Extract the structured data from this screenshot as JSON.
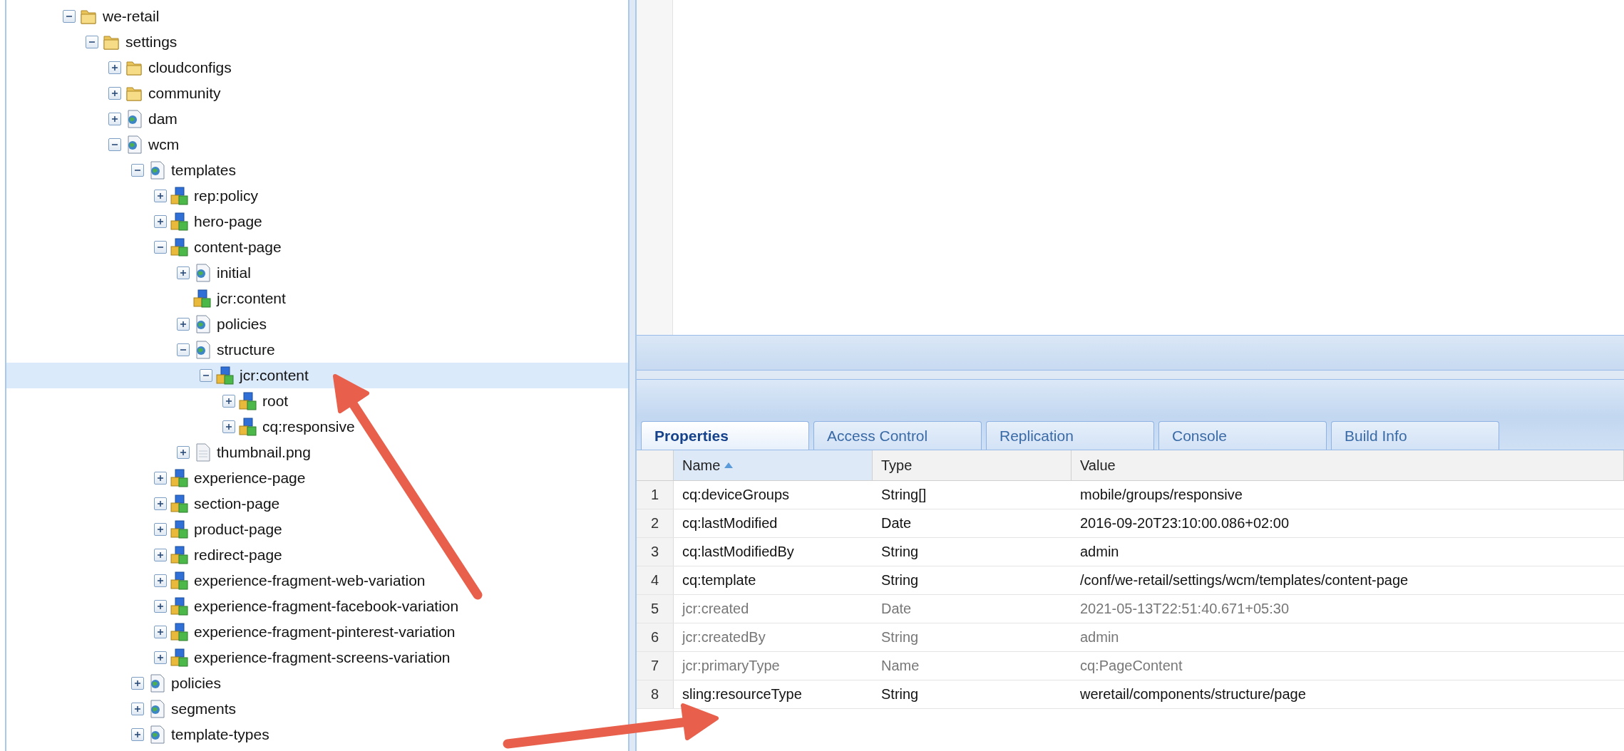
{
  "tree": [
    {
      "label": "we-retail",
      "kind": "folder",
      "leaf": false,
      "expanded": true,
      "selected": false,
      "children": [
        {
          "label": "settings",
          "kind": "folder",
          "leaf": false,
          "expanded": true,
          "selected": false,
          "children": [
            {
              "label": "cloudconfigs",
              "kind": "folder",
              "leaf": false,
              "expanded": false,
              "selected": false
            },
            {
              "label": "community",
              "kind": "folder",
              "leaf": false,
              "expanded": false,
              "selected": false
            },
            {
              "label": "dam",
              "kind": "page",
              "leaf": false,
              "expanded": false,
              "selected": false
            },
            {
              "label": "wcm",
              "kind": "page",
              "leaf": false,
              "expanded": true,
              "selected": false,
              "children": [
                {
                  "label": "templates",
                  "kind": "page",
                  "leaf": false,
                  "expanded": true,
                  "selected": false,
                  "children": [
                    {
                      "label": "rep:policy",
                      "kind": "node",
                      "leaf": false,
                      "expanded": false,
                      "selected": false
                    },
                    {
                      "label": "hero-page",
                      "kind": "node",
                      "leaf": false,
                      "expanded": false,
                      "selected": false
                    },
                    {
                      "label": "content-page",
                      "kind": "node",
                      "leaf": false,
                      "expanded": true,
                      "selected": false,
                      "children": [
                        {
                          "label": "initial",
                          "kind": "page",
                          "leaf": false,
                          "expanded": false,
                          "selected": false
                        },
                        {
                          "label": "jcr:content",
                          "kind": "node",
                          "leaf": true,
                          "selected": false
                        },
                        {
                          "label": "policies",
                          "kind": "page",
                          "leaf": false,
                          "expanded": false,
                          "selected": false
                        },
                        {
                          "label": "structure",
                          "kind": "page",
                          "leaf": false,
                          "expanded": true,
                          "selected": false,
                          "children": [
                            {
                              "label": "jcr:content",
                              "kind": "node",
                              "leaf": false,
                              "expanded": true,
                              "selected": true,
                              "children": [
                                {
                                  "label": "root",
                                  "kind": "node",
                                  "leaf": false,
                                  "expanded": false,
                                  "selected": false
                                },
                                {
                                  "label": "cq:responsive",
                                  "kind": "node",
                                  "leaf": false,
                                  "expanded": false,
                                  "selected": false
                                }
                              ]
                            }
                          ]
                        },
                        {
                          "label": "thumbnail.png",
                          "kind": "file",
                          "leaf": false,
                          "expanded": false,
                          "selected": false
                        }
                      ]
                    },
                    {
                      "label": "experience-page",
                      "kind": "node",
                      "leaf": false,
                      "expanded": false,
                      "selected": false
                    },
                    {
                      "label": "section-page",
                      "kind": "node",
                      "leaf": false,
                      "expanded": false,
                      "selected": false
                    },
                    {
                      "label": "product-page",
                      "kind": "node",
                      "leaf": false,
                      "expanded": false,
                      "selected": false
                    },
                    {
                      "label": "redirect-page",
                      "kind": "node",
                      "leaf": false,
                      "expanded": false,
                      "selected": false
                    },
                    {
                      "label": "experience-fragment-web-variation",
                      "kind": "node",
                      "leaf": false,
                      "expanded": false,
                      "selected": false
                    },
                    {
                      "label": "experience-fragment-facebook-variation",
                      "kind": "node",
                      "leaf": false,
                      "expanded": false,
                      "selected": false
                    },
                    {
                      "label": "experience-fragment-pinterest-variation",
                      "kind": "node",
                      "leaf": false,
                      "expanded": false,
                      "selected": false
                    },
                    {
                      "label": "experience-fragment-screens-variation",
                      "kind": "node",
                      "leaf": false,
                      "expanded": false,
                      "selected": false
                    }
                  ]
                },
                {
                  "label": "policies",
                  "kind": "page",
                  "leaf": false,
                  "expanded": false,
                  "selected": false
                },
                {
                  "label": "segments",
                  "kind": "page",
                  "leaf": false,
                  "expanded": false,
                  "selected": false
                },
                {
                  "label": "template-types",
                  "kind": "page",
                  "leaf": false,
                  "expanded": false,
                  "selected": false
                }
              ]
            }
          ]
        }
      ]
    }
  ],
  "tabs": [
    {
      "label": "Properties",
      "selected": true
    },
    {
      "label": "Access Control",
      "selected": false
    },
    {
      "label": "Replication",
      "selected": false
    },
    {
      "label": "Console",
      "selected": false
    },
    {
      "label": "Build Info",
      "selected": false
    }
  ],
  "properties": {
    "columns": [
      {
        "label": "Name",
        "sorted": true
      },
      {
        "label": "Type",
        "sorted": false
      },
      {
        "label": "Value",
        "sorted": false
      }
    ],
    "rows": [
      {
        "index": "1",
        "name": "cq:deviceGroups",
        "type": "String[]",
        "value": "mobile/groups/responsive",
        "protected": false
      },
      {
        "index": "2",
        "name": "cq:lastModified",
        "type": "Date",
        "value": "2016-09-20T23:10:00.086+02:00",
        "protected": false
      },
      {
        "index": "3",
        "name": "cq:lastModifiedBy",
        "type": "String",
        "value": "admin",
        "protected": false
      },
      {
        "index": "4",
        "name": "cq:template",
        "type": "String",
        "value": "/conf/we-retail/settings/wcm/templates/content-page",
        "protected": false
      },
      {
        "index": "5",
        "name": "jcr:created",
        "type": "Date",
        "value": "2021-05-13T22:51:40.671+05:30",
        "protected": true
      },
      {
        "index": "6",
        "name": "jcr:createdBy",
        "type": "String",
        "value": "admin",
        "protected": true
      },
      {
        "index": "7",
        "name": "jcr:primaryType",
        "type": "Name",
        "value": "cq:PageContent",
        "protected": true
      },
      {
        "index": "8",
        "name": "sling:resourceType",
        "type": "String",
        "value": "weretail/components/structure/page",
        "protected": false
      }
    ]
  }
}
